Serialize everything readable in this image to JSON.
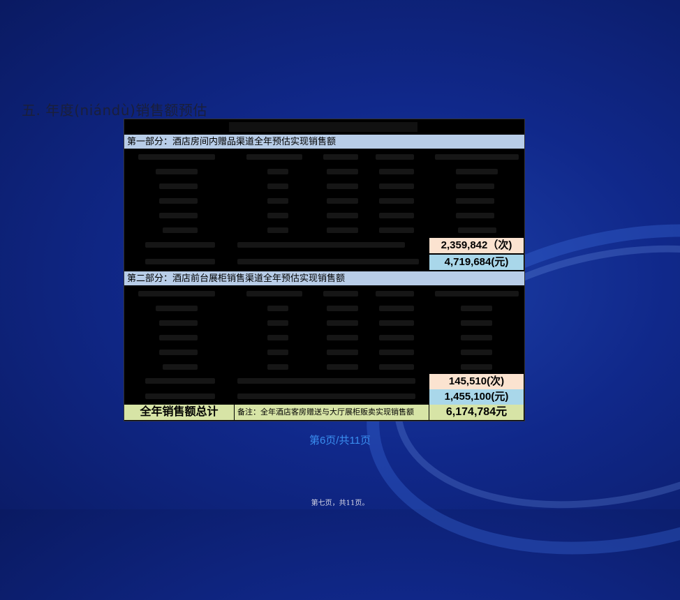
{
  "slide": {
    "title": "五. 年度(niándù)销售额预估",
    "page_number": "第6页/共11页",
    "footer": "第七页，共11页。"
  },
  "table": {
    "section1": {
      "header": "第一部分：酒店房间内赠品渠道全年预估实现销售额",
      "count_value": "2,359,842（次)",
      "amount_value": "4,719,684(元)"
    },
    "section2": {
      "header": "第二部分：酒店前台展柜销售渠道全年预估实现销售额",
      "count_value": "145,510(次)",
      "amount_value": "1,455,100(元)"
    },
    "total": {
      "label": "全年销售额总计",
      "note": "备注：全年酒店客房赠送与大厅展柜贩卖实现销售额",
      "value": "6,174,784元"
    }
  },
  "colors": {
    "band": "#b8cde8",
    "peach": "#fbe3d0",
    "lightblue": "#a9d7ea",
    "total": "#d7e4a6",
    "page_number": "#3a8ef0"
  }
}
